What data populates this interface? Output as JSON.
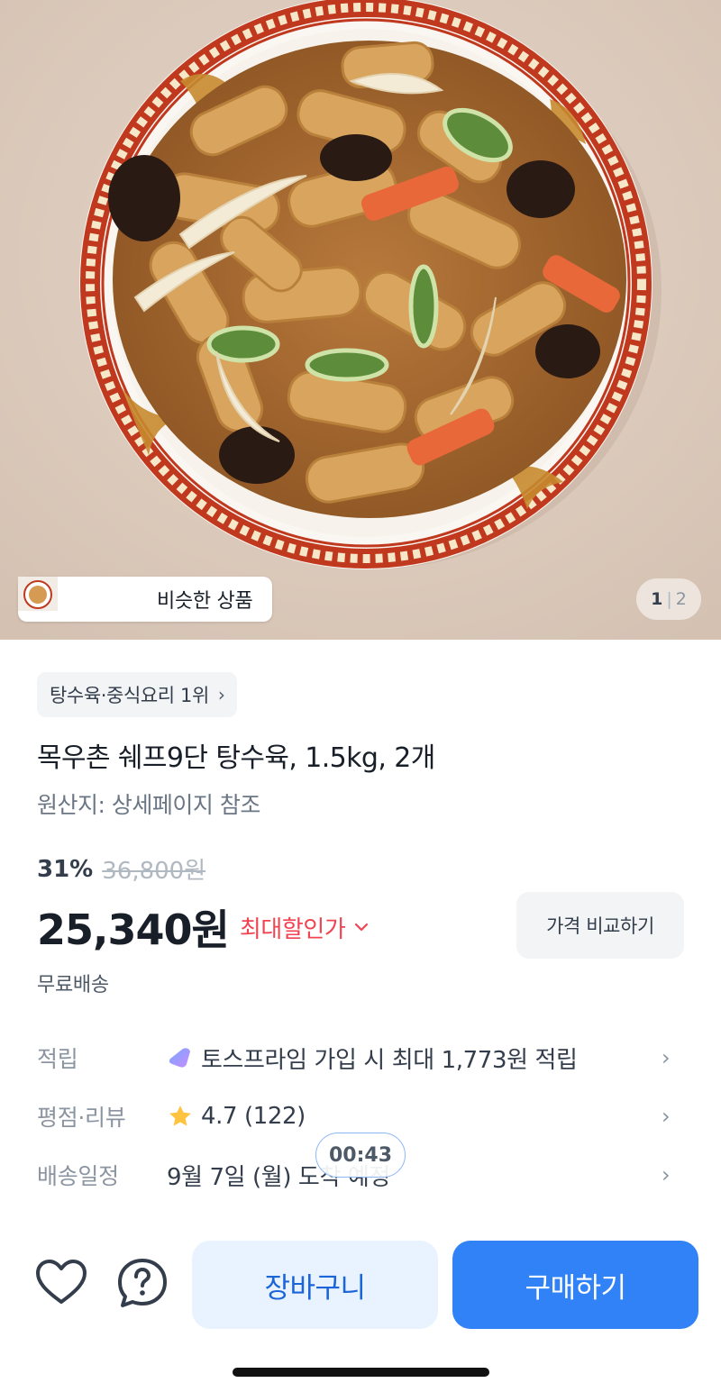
{
  "hero": {
    "similar_label": "비슷한 상품",
    "page_current": "1",
    "page_separator": "|",
    "page_total": "2"
  },
  "product": {
    "rank_chip": "탕수육·중식요리 1위",
    "title": "목우촌 쉐프9단 탕수육, 1.5kg, 2개",
    "origin": "원산지: 상세페이지 참조",
    "discount_rate": "31%",
    "original_price": "36,800원",
    "price": "25,340원",
    "max_discount_label": "최대할인가",
    "compare_button": "가격 비교하기",
    "shipping": "무료배송"
  },
  "info_rows": [
    {
      "label": "적립",
      "value": "토스프라임 가입 시 최대 1,773원 적립",
      "icon": "toss-prime-icon"
    },
    {
      "label": "평점·리뷰",
      "value": "4.7 (122)",
      "icon": "star-icon"
    },
    {
      "label": "배송일정",
      "value": "9월 7일 (월) 도착 예정",
      "icon": ""
    }
  ],
  "timer": "00:43",
  "bottom_bar": {
    "cart_label": "장바구니",
    "buy_label": "구매하기"
  },
  "colors": {
    "accent": "#3182f6",
    "accent_light": "#e8f3ff",
    "discount_red": "#f04452",
    "star": "#ffc342"
  }
}
